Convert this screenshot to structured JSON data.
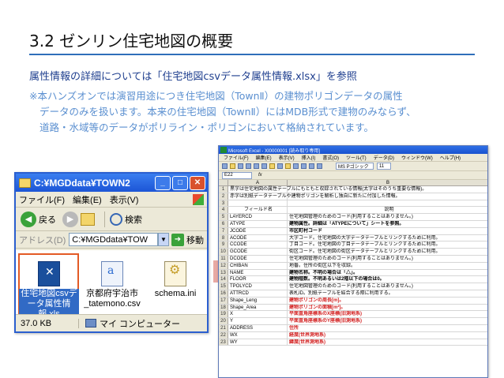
{
  "slide": {
    "title": "3.2 ゼンリン住宅地図の概要",
    "line1": "属性情報の詳細については「住宅地図csvデータ属性情報.xlsx」を参照",
    "note_lines": [
      "※本ハンズオンでは演習用途につき住宅地図（TownⅡ）の建物ポリゴンデータの属性",
      "データのみを扱います。本来の住宅地図（TownⅡ）にはMDB形式で建物のみならず、",
      "道路・水域等のデータがポリライン・ポリゴンにおいて格納されています。"
    ],
    "accent_color": "#2f6fba"
  },
  "explorer": {
    "title": "C:¥MGDdata¥TOWN2",
    "menu": [
      "ファイル(F)",
      "編集(E)",
      "表示(V)"
    ],
    "toolbar": {
      "back": "戻る",
      "search": "検索"
    },
    "address_label": "アドレス(D)",
    "address_value": "C:¥MGDdata¥TOW",
    "go_label": "移動",
    "files": [
      {
        "name": "住宅地図csvデータ属性情報.xls",
        "icon": "excel-file-icon",
        "selected": true
      },
      {
        "name": "京都府宇治市_tatemono.csv",
        "icon": "csv-file-icon",
        "selected": false
      },
      {
        "name": "schema.ini",
        "icon": "ini-file-icon",
        "selected": false
      }
    ],
    "status_size": "37.0 KB",
    "status_location": "マイ コンピューター"
  },
  "excel": {
    "title": "Microsoft Excel - XI0000001 [読み取り専用]",
    "menu": [
      "ファイル(F)",
      "編集(E)",
      "表示(V)",
      "挿入(I)",
      "書式(O)",
      "ツール(T)",
      "データ(D)",
      "ウィンドウ(W)",
      "ヘルプ(H)"
    ],
    "font": "MS Pゴシック",
    "font_size": "11",
    "cell_ref": "E22",
    "columns": [
      "A",
      "B"
    ],
    "rows": [
      {
        "n": "1",
        "a": "黒字は住宅地図の属性テーブルにもともと収録されている情報(太字はそのうち重要な情報)。",
        "b": "",
        "style": ""
      },
      {
        "n": "2",
        "a": "赤字は別紙データテーブルや建物ポリゴンを解析し独自に新たに付加した情報。",
        "b": "",
        "style": ""
      },
      {
        "n": "3",
        "a": "",
        "b": "",
        "style": ""
      },
      {
        "n": "4",
        "a": "フィールド名",
        "b": "説明",
        "style": "hdr"
      },
      {
        "n": "5",
        "a": "LAYERCD",
        "b": "住宅地図管理のためのコード(利用することはありません。)",
        "style": ""
      },
      {
        "n": "6",
        "a": "ATYPE",
        "b": "建物属性。詳細は「ATYPEについて」シートを参照。",
        "style": "bold"
      },
      {
        "n": "7",
        "a": "JCODE",
        "b": "市区町村コード",
        "style": "bold"
      },
      {
        "n": "8",
        "a": "ACODE",
        "b": "大字コード。住宅地図の大字データテーブルとリンクするために利用。",
        "style": ""
      },
      {
        "n": "9",
        "a": "CCODE",
        "b": "丁目コード。住宅地図の丁目データテーブルとリンクするために利用。",
        "style": ""
      },
      {
        "n": "10",
        "a": "GCODE",
        "b": "街区コード。住宅地図の街区データテーブルとリンクするために利用。",
        "style": ""
      },
      {
        "n": "11",
        "a": "DCODE",
        "b": "住宅地図管理のためのコード(利用することはありません。)",
        "style": ""
      },
      {
        "n": "12",
        "a": "CHIBAN",
        "b": "地番。住所の街区以下を収録。",
        "style": ""
      },
      {
        "n": "13",
        "a": "NAME",
        "b": "建物名称。不明の場合は「△」。",
        "style": "bold"
      },
      {
        "n": "14",
        "a": "FLOOR",
        "b": "建物階数。不明あるいは2階以下の場合は0。",
        "style": "bold"
      },
      {
        "n": "15",
        "a": "TPOLYCD",
        "b": "住宅地図管理のためのコード(利用することはありません。)",
        "style": ""
      },
      {
        "n": "16",
        "a": "ATTRCD",
        "b": "表札ID。別紙テーブルを結合する際に利用する。",
        "style": ""
      },
      {
        "n": "17",
        "a": "Shape_Leng",
        "b": "建物ポリゴンの周長[m]。",
        "style": "red"
      },
      {
        "n": "18",
        "a": "Shape_Area",
        "b": "建物ポリゴンの面積[m²]。",
        "style": "red"
      },
      {
        "n": "19",
        "a": "X",
        "b": "平面直角座標系のX座標(旧測地系)",
        "style": "red"
      },
      {
        "n": "20",
        "a": "Y",
        "b": "平面直角座標系のY座標(旧測地系)",
        "style": "red"
      },
      {
        "n": "21",
        "a": "ADDRESS",
        "b": "住所",
        "style": "red"
      },
      {
        "n": "22",
        "a": "WX",
        "b": "経度(世界測地系)",
        "style": "red"
      },
      {
        "n": "23",
        "a": "WY",
        "b": "緯度(世界測地系)",
        "style": "red"
      }
    ]
  }
}
